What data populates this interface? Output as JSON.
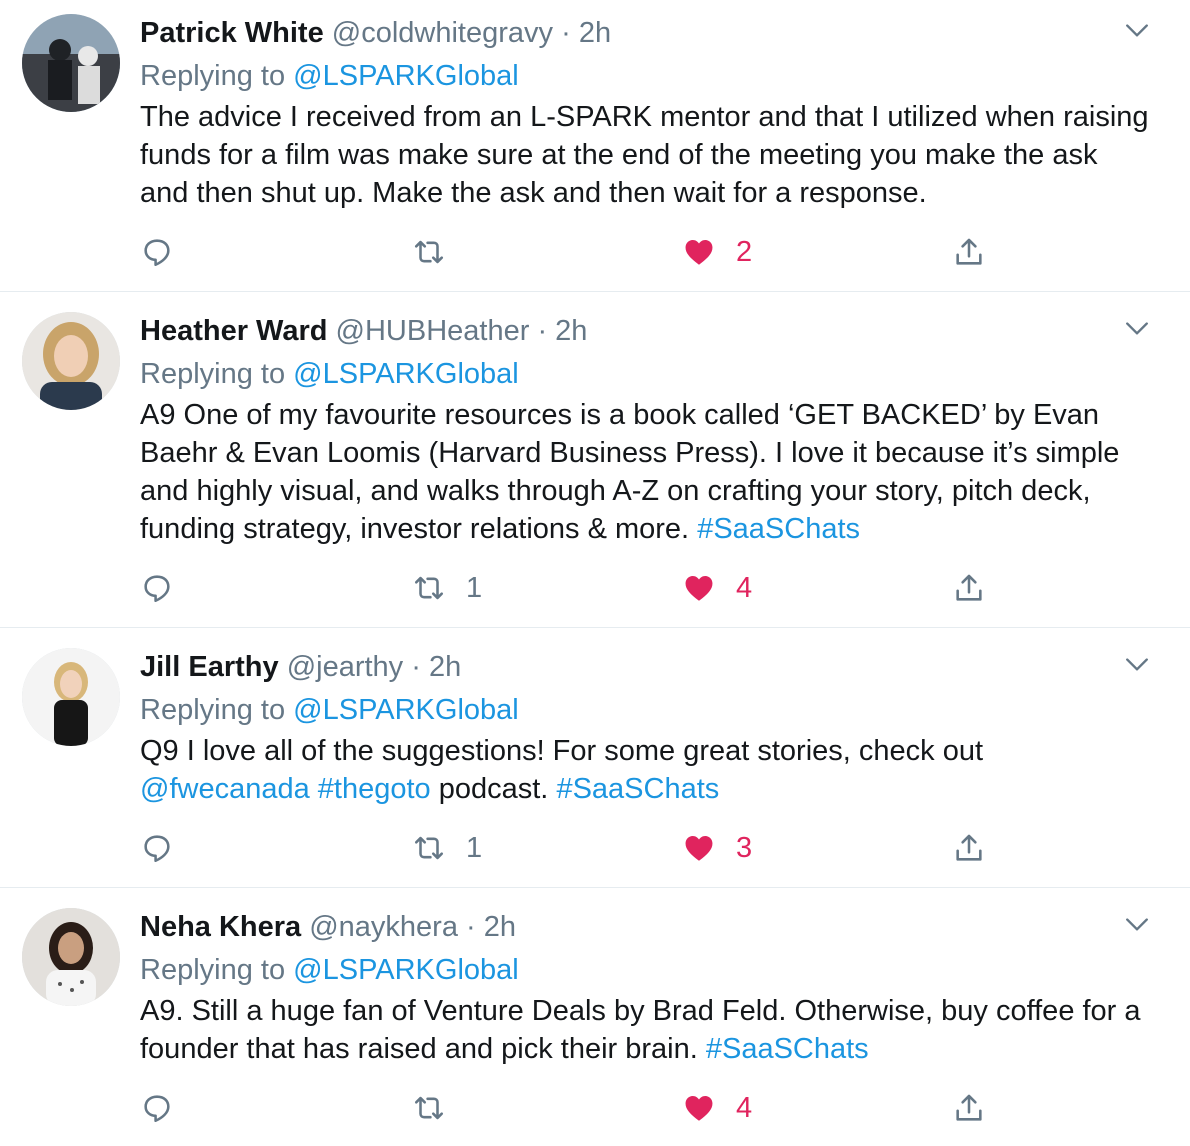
{
  "tweets": [
    {
      "name": "Patrick White",
      "handle": "@coldwhitegravy",
      "separator": "·",
      "time": "2h",
      "replying_prefix": "Replying to",
      "replying_to": "@LSPARKGlobal",
      "text_parts": [
        "The advice I received from an L-SPARK mentor and that I utilized when raising funds for a film was make sure at the end of the meeting you make the ask and then shut up. Make the ask and then wait for a response."
      ],
      "retweets": "",
      "likes": "2",
      "liked": true
    },
    {
      "name": "Heather Ward",
      "handle": "@HUBHeather",
      "separator": "·",
      "time": "2h",
      "replying_prefix": "Replying to",
      "replying_to": "@LSPARKGlobal",
      "text_parts": [
        "A9 One of my favourite resources is a book called ‘GET BACKED’ by Evan Baehr & Evan Loomis (Harvard Business Press). I love it because it’s simple and highly visual, and walks through A-Z on crafting your story, pitch deck, funding strategy, investor relations & more.",
        "#SaaSChats"
      ],
      "retweets": "1",
      "likes": "4",
      "liked": true
    },
    {
      "name": "Jill Earthy",
      "handle": "@jearthy",
      "separator": "·",
      "time": "2h",
      "replying_prefix": "Replying to",
      "replying_to": "@LSPARKGlobal",
      "text_parts": [
        "Q9 I love all of the suggestions! For some great stories, check out",
        "@fwecanada",
        "#thegoto",
        "podcast.",
        "#SaaSChats"
      ],
      "retweets": "1",
      "likes": "3",
      "liked": true
    },
    {
      "name": "Neha Khera",
      "handle": "@naykhera",
      "separator": "·",
      "time": "2h",
      "replying_prefix": "Replying to",
      "replying_to": "@LSPARKGlobal",
      "text_parts": [
        "A9. Still a huge fan of Venture Deals by Brad Feld. Otherwise, buy coffee for a founder that has raised and pick their brain.",
        "#SaaSChats"
      ],
      "retweets": "",
      "likes": "4",
      "liked": true
    }
  ],
  "icons": {
    "reply": "reply-icon",
    "retweet": "retweet-icon",
    "like": "heart-icon",
    "share": "share-icon",
    "more": "chevron-down-icon"
  },
  "colors": {
    "link": "#1b95e0",
    "muted": "#657786",
    "like": "#e0245e",
    "divider": "#e6ecf0"
  }
}
